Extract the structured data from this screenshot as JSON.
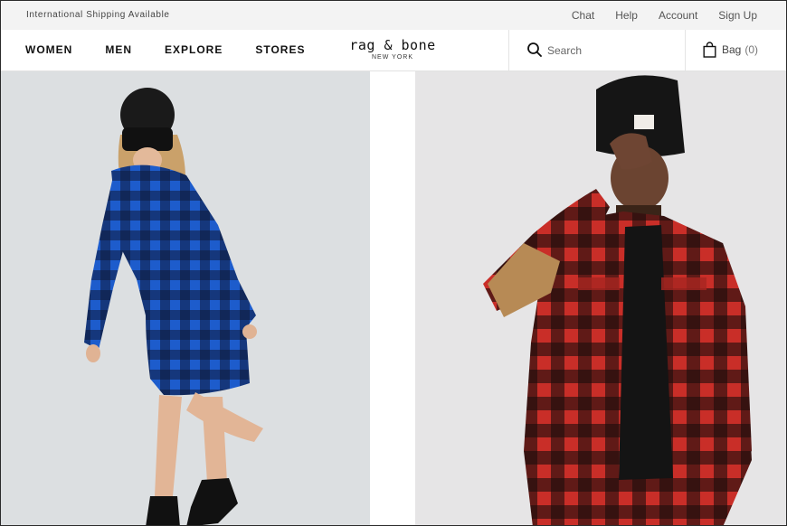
{
  "topbar": {
    "promo": "International Shipping Available",
    "links": [
      "Chat",
      "Help",
      "Account",
      "Sign Up"
    ]
  },
  "nav": {
    "items": [
      "WOMEN",
      "MEN",
      "EXPLORE",
      "STORES"
    ],
    "logo": "rag & bone",
    "logo_sub": "NEW YORK",
    "search_placeholder": "Search",
    "bag_label": "Bag",
    "bag_count": "(0)"
  },
  "colors": {
    "utility_bg": "#f3f3f3",
    "left_bg": "#dcdfe1",
    "right_bg": "#e6e5e6",
    "blue_plaid": "#1f5fcf",
    "red_plaid": "#c9302a"
  },
  "icons": {
    "search": "search-icon",
    "bag": "shopping-bag-icon"
  }
}
